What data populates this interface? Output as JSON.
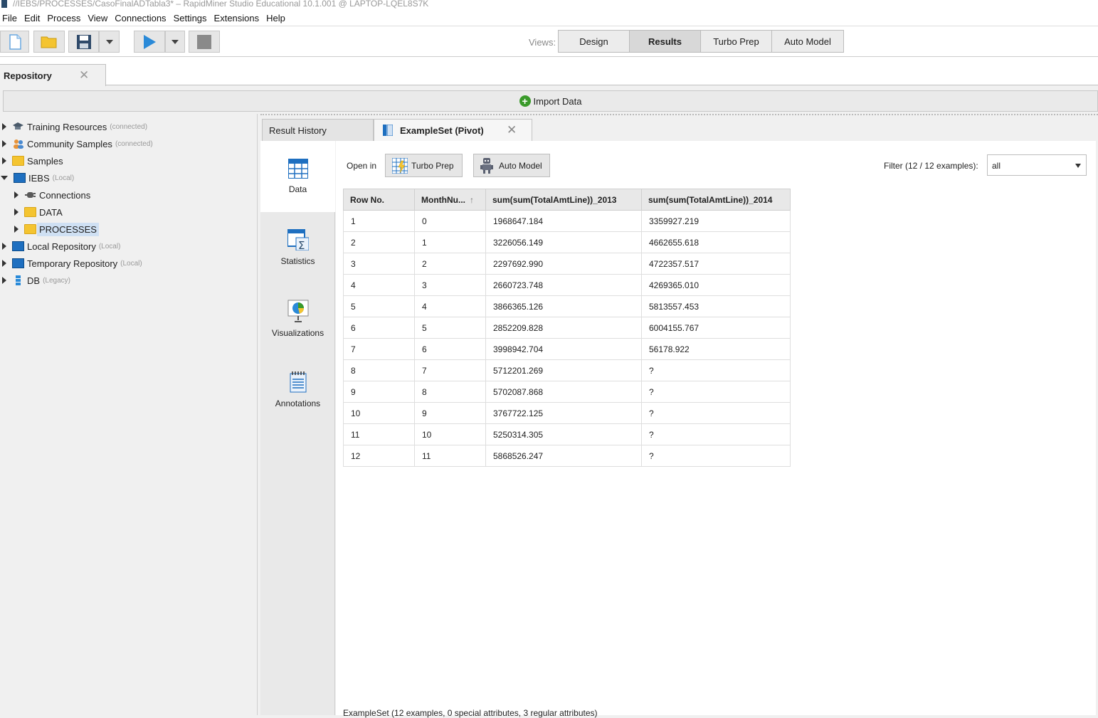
{
  "window": {
    "title": "//IEBS/PROCESSES/CasoFinalADTabla3* – RapidMiner Studio Educational 10.1.001 @ LAPTOP-LQEL8S7K"
  },
  "menu": [
    "File",
    "Edit",
    "Process",
    "View",
    "Connections",
    "Settings",
    "Extensions",
    "Help"
  ],
  "toolbar": {
    "views_label": "Views:",
    "view_tabs": [
      "Design",
      "Results",
      "Turbo Prep",
      "Auto Model"
    ],
    "active_view": "Results"
  },
  "repository": {
    "tab_label": "Repository",
    "import_label": "Import Data",
    "tree": [
      {
        "label": "Training Resources",
        "sub": "(connected)"
      },
      {
        "label": "Community Samples",
        "sub": "(connected)"
      },
      {
        "label": "Samples",
        "sub": ""
      },
      {
        "label": "IEBS",
        "sub": "(Local)"
      },
      {
        "label": "Connections",
        "sub": ""
      },
      {
        "label": "DATA",
        "sub": ""
      },
      {
        "label": "PROCESSES",
        "sub": ""
      },
      {
        "label": "Local Repository",
        "sub": "(Local)"
      },
      {
        "label": "Temporary Repository",
        "sub": "(Local)"
      },
      {
        "label": "DB",
        "sub": "(Legacy)"
      }
    ]
  },
  "results": {
    "tabs": {
      "history": "Result History",
      "active": "ExampleSet (Pivot)"
    },
    "nav": [
      "Data",
      "Statistics",
      "Visualizations",
      "Annotations"
    ],
    "open_in_label": "Open in",
    "open_buttons": [
      "Turbo Prep",
      "Auto Model"
    ],
    "filter_label": "Filter (12 / 12 examples):",
    "filter_value": "all",
    "table": {
      "headers": [
        "Row No.",
        "MonthNu...",
        "sum(sum(TotalAmtLine))_2013",
        "sum(sum(TotalAmtLine))_2014"
      ],
      "rows": [
        [
          "1",
          "0",
          "1968647.184",
          "3359927.219"
        ],
        [
          "2",
          "1",
          "3226056.149",
          "4662655.618"
        ],
        [
          "3",
          "2",
          "2297692.990",
          "4722357.517"
        ],
        [
          "4",
          "3",
          "2660723.748",
          "4269365.010"
        ],
        [
          "5",
          "4",
          "3866365.126",
          "5813557.453"
        ],
        [
          "6",
          "5",
          "2852209.828",
          "6004155.767"
        ],
        [
          "7",
          "6",
          "3998942.704",
          "56178.922"
        ],
        [
          "8",
          "7",
          "5712201.269",
          "?"
        ],
        [
          "9",
          "8",
          "5702087.868",
          "?"
        ],
        [
          "10",
          "9",
          "3767722.125",
          "?"
        ],
        [
          "11",
          "10",
          "5250314.305",
          "?"
        ],
        [
          "12",
          "11",
          "5868526.247",
          "?"
        ]
      ]
    },
    "status": "ExampleSet (12 examples, 0 special attributes, 3 regular attributes)"
  },
  "colors": {
    "accent_blue": "#1e6fc0",
    "play_blue": "#2a8ad8",
    "import_green": "#3a9a2a",
    "folder_yellow": "#f4c430"
  }
}
